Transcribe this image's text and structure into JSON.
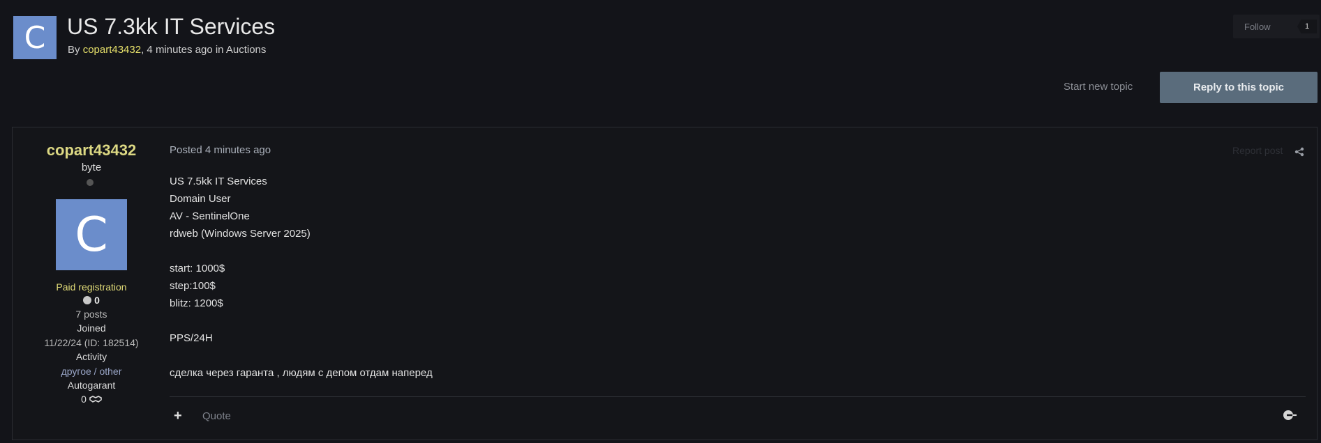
{
  "topic": {
    "avatar_letter": "C",
    "title": "US 7.3kk IT Services",
    "by_prefix": "By ",
    "author": "copart43432",
    "time_sep": ", 4 minutes ago in ",
    "forum": "Auctions"
  },
  "follow": {
    "label": "Follow",
    "count": "1"
  },
  "actions": {
    "start_new_topic": "Start new topic",
    "reply": "Reply to this topic"
  },
  "post": {
    "author": {
      "name": "copart43432",
      "rank": "byte",
      "avatar_letter": "C",
      "group": "Paid registration",
      "reputation": "0",
      "posts": "7 posts",
      "joined_label": "Joined",
      "joined_value": "11/22/24 (ID: 182514)",
      "activity_label": "Activity",
      "activity_value": "другое / other",
      "autogarant_label": "Autogarant",
      "autogarant_value": "0"
    },
    "posted": "Posted 4 minutes ago",
    "report": "Report post",
    "lines": [
      "US 7.5kk IT Services",
      "Domain User",
      "AV - SentinelOne",
      "rdweb (Windows Server 2025)",
      "",
      "start: 1000$",
      "step:100$",
      "blitz: 1200$",
      "",
      "PPS/24H",
      "",
      "сделка через гаранта , людям с депом отдам наперед"
    ],
    "quote_label": "Quote",
    "plus_label": "+"
  },
  "colors": {
    "background": "#131419",
    "avatar": "#6b8dcb",
    "username": "#dcd883",
    "reply_button": "#5a6c7c"
  }
}
